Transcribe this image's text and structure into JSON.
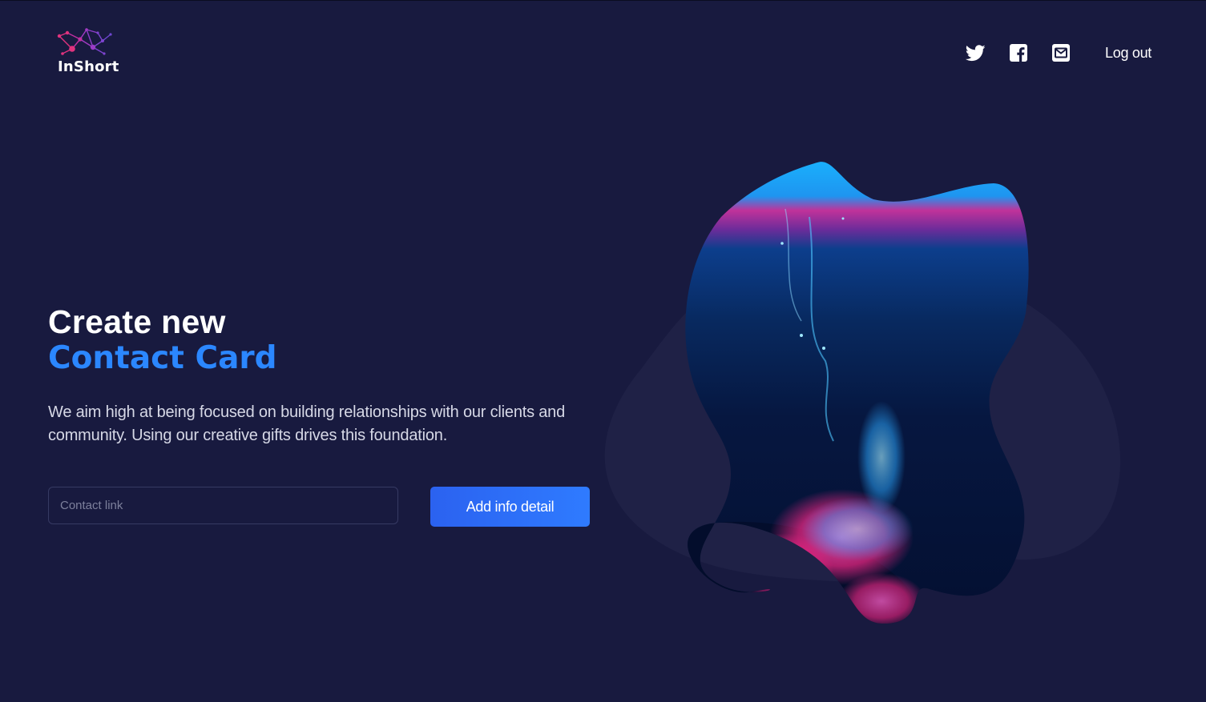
{
  "brand": {
    "name": "InShort",
    "logo_icon": "network-nodes-logo-icon"
  },
  "nav": {
    "icons": [
      "twitter-icon",
      "facebook-icon",
      "mail-icon"
    ],
    "logout_label": "Log out"
  },
  "hero": {
    "title_line1": "Create new",
    "title_line2": "Contact Card",
    "description": "We aim high at being focused on building relationships with our clients and community. Using our creative gifts drives this foundation.",
    "input_placeholder": "Contact link",
    "input_value": "",
    "button_label": "Add info detail"
  },
  "colors": {
    "background": "#181a3f",
    "accent": "#2b87ff",
    "button": "#2f6fff",
    "text": "#ffffff"
  }
}
